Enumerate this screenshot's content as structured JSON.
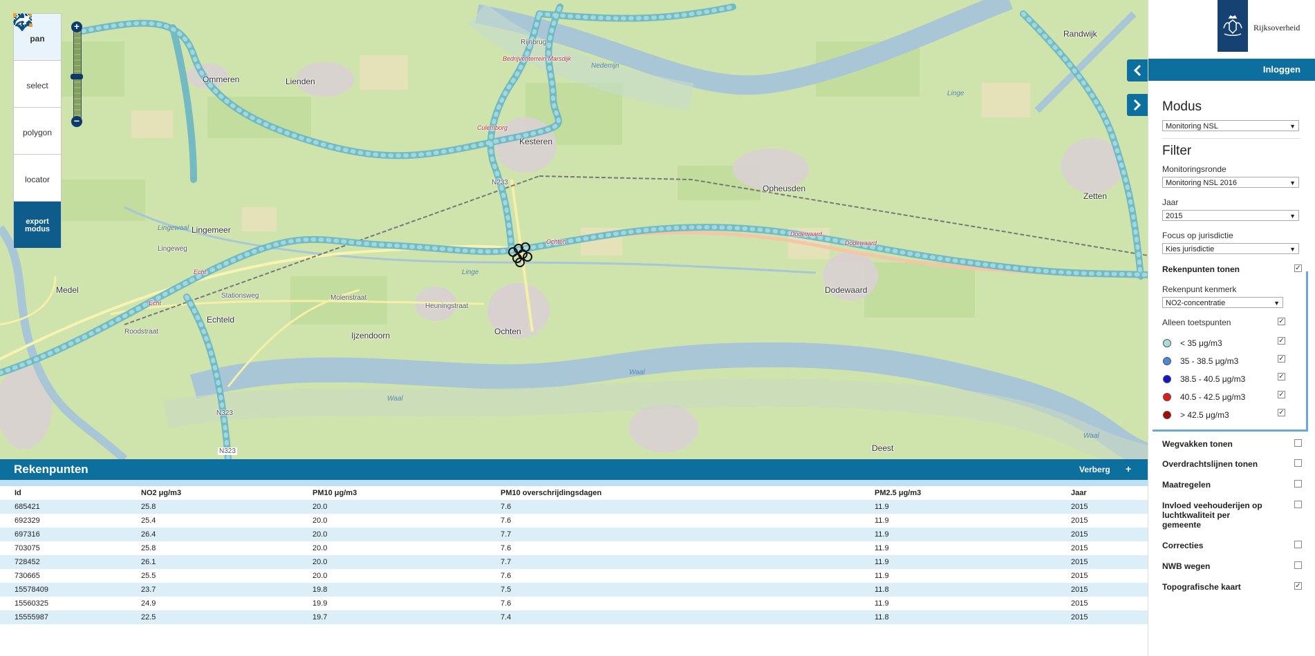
{
  "map": {
    "places": [
      "Ommeren",
      "Lienden",
      "Kesteren",
      "Opheusden",
      "Lingemeer",
      "Echteld",
      "Medel",
      "Ijzendoorn",
      "Ochten",
      "Dodewaard",
      "Zetten",
      "Randwijk",
      "Deest",
      "Rijnbrug",
      "Bedrijventerrein Marsdijk",
      "Culemborg",
      "Stationsweg",
      "Molenstraat",
      "Heuningstraat",
      "Lingeweg",
      "Ochten",
      "Dodewaard",
      "Dodewaard",
      "N323",
      "N323",
      "N233",
      "Waal",
      "Waal",
      "Waal",
      "Nederrijn",
      "Linge",
      "Echt",
      "Echt",
      "Roodstraat",
      "Lingewaal",
      "Linge"
    ]
  },
  "tools": {
    "pan": "pan",
    "select": "select",
    "polygon": "polygon",
    "locator": "locator",
    "export_line1": "export",
    "export_line2": "modus"
  },
  "panel": {
    "brand": "Rijksoverheid",
    "login": "Inloggen",
    "modus_title": "Modus",
    "modus_value": "Monitoring NSL",
    "filter_title": "Filter",
    "monitoringsronde_label": "Monitoringsronde",
    "monitoringsronde_value": "Monitoring NSL 2016",
    "jaar_label": "Jaar",
    "jaar_value": "2015",
    "focus_label": "Focus op jurisdictie",
    "focus_value": "Kies jurisdictie",
    "rekenpunten_label": "Rekenpunten tonen",
    "kenmerk_label": "Rekenpunt kenmerk",
    "kenmerk_value": "NO2-concentratie",
    "alleen_label": "Alleen toetspunten",
    "legend": [
      {
        "label": "< 35 μg/m3",
        "color": "#a8dcd8"
      },
      {
        "label": "35 - 38.5 μg/m3",
        "color": "#4f86d6"
      },
      {
        "label": "38.5 - 40.5 μg/m3",
        "color": "#1515c8"
      },
      {
        "label": "40.5 - 42.5 μg/m3",
        "color": "#e01c1c"
      },
      {
        "label": "> 42.5 μg/m3",
        "color": "#a80808"
      }
    ],
    "layers": [
      {
        "label": "Wegvakken tonen",
        "checked": false
      },
      {
        "label": "Overdrachtslijnen tonen",
        "checked": false
      },
      {
        "label": "Maatregelen",
        "checked": false
      },
      {
        "label": "Invloed veehouderijen op luchtkwaliteit per gemeente",
        "checked": false
      },
      {
        "label": "Correcties",
        "checked": false
      },
      {
        "label": "NWB wegen",
        "checked": false
      },
      {
        "label": "Topografische kaart",
        "checked": true
      }
    ]
  },
  "table": {
    "title": "Rekenpunten",
    "hide": "Verberg",
    "plus": "+",
    "headers": [
      "Id",
      "NO2 μg/m3",
      "PM10 μg/m3",
      "PM10 overschrijdingsdagen",
      "PM2.5 μg/m3",
      "Jaar"
    ],
    "rows": [
      [
        "685421",
        "25.8",
        "20.0",
        "7.6",
        "11.9",
        "2015"
      ],
      [
        "692329",
        "25.4",
        "20.0",
        "7.6",
        "11.9",
        "2015"
      ],
      [
        "697316",
        "26.4",
        "20.0",
        "7.7",
        "11.9",
        "2015"
      ],
      [
        "703075",
        "25.8",
        "20.0",
        "7.6",
        "11.9",
        "2015"
      ],
      [
        "728452",
        "26.1",
        "20.0",
        "7.7",
        "11.9",
        "2015"
      ],
      [
        "730665",
        "25.5",
        "20.0",
        "7.6",
        "11.9",
        "2015"
      ],
      [
        "15578409",
        "23.7",
        "19.8",
        "7.5",
        "11.8",
        "2015"
      ],
      [
        "15560325",
        "24.9",
        "19.9",
        "7.6",
        "11.9",
        "2015"
      ],
      [
        "15555987",
        "22.5",
        "19.7",
        "7.4",
        "11.8",
        "2015"
      ]
    ]
  }
}
